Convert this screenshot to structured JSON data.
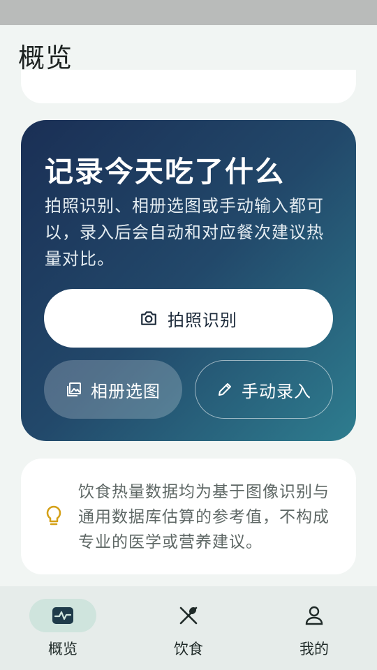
{
  "header": {
    "title": "概览"
  },
  "hero": {
    "title": "记录今天吃了什么",
    "description": "拍照识别、相册选图或手动输入都可以，录入后会自动和对应餐次建议热量对比。",
    "camera_label": "拍照识别",
    "album_label": "相册选图",
    "manual_label": "手动录入"
  },
  "notice": {
    "text": "饮食热量数据均为基于图像识别与通用数据库估算的参考值，不构成专业的医学或营养建议。",
    "icon": "lightbulb-icon",
    "icon_color": "#d4a017"
  },
  "nav": {
    "items": [
      {
        "label": "概览",
        "icon": "activity-icon",
        "active": true
      },
      {
        "label": "饮食",
        "icon": "utensils-icon",
        "active": false
      },
      {
        "label": "我的",
        "icon": "person-icon",
        "active": false
      }
    ]
  },
  "colors": {
    "hero_gradient_start": "#1a2f55",
    "hero_gradient_end": "#2e7d8f",
    "nav_active_pill": "#cfe4dd",
    "page_background": "#f1f5f3"
  }
}
